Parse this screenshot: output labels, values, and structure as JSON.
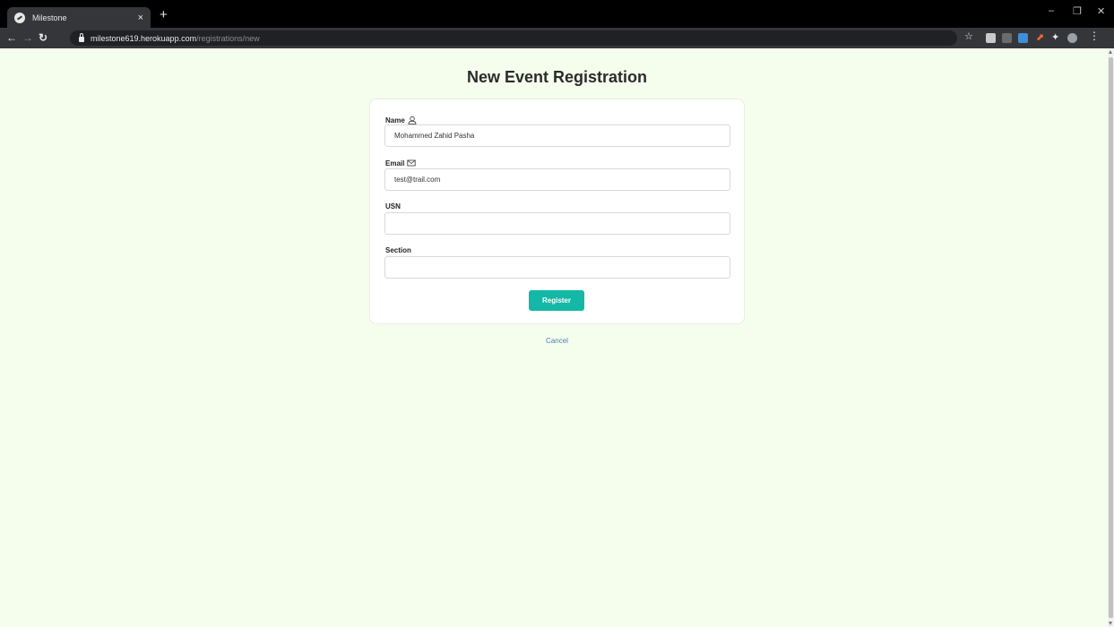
{
  "browser": {
    "tab_title": "Milestone",
    "tab_close": "×",
    "new_tab": "+",
    "url_host": "milestone619.herokuapp.com",
    "url_path": "/registrations/new",
    "window_controls": [
      "–",
      "❐",
      "✕"
    ]
  },
  "page": {
    "title": "New Event Registration"
  },
  "form": {
    "name_label": "Name",
    "name_value": "Mohammed Zahid Pasha",
    "email_label": "Email",
    "email_value": "test@trail.com",
    "usn_label": "USN",
    "usn_value": "",
    "section_label": "Section",
    "section_value": "",
    "submit_label": "Register",
    "cancel_label": "Cancel"
  },
  "colors": {
    "page_background": "#f5fded",
    "button": "#13b8a6",
    "link": "#4a7fb5"
  },
  "icons": {
    "name": "user-icon",
    "email": "envelope-icon"
  }
}
